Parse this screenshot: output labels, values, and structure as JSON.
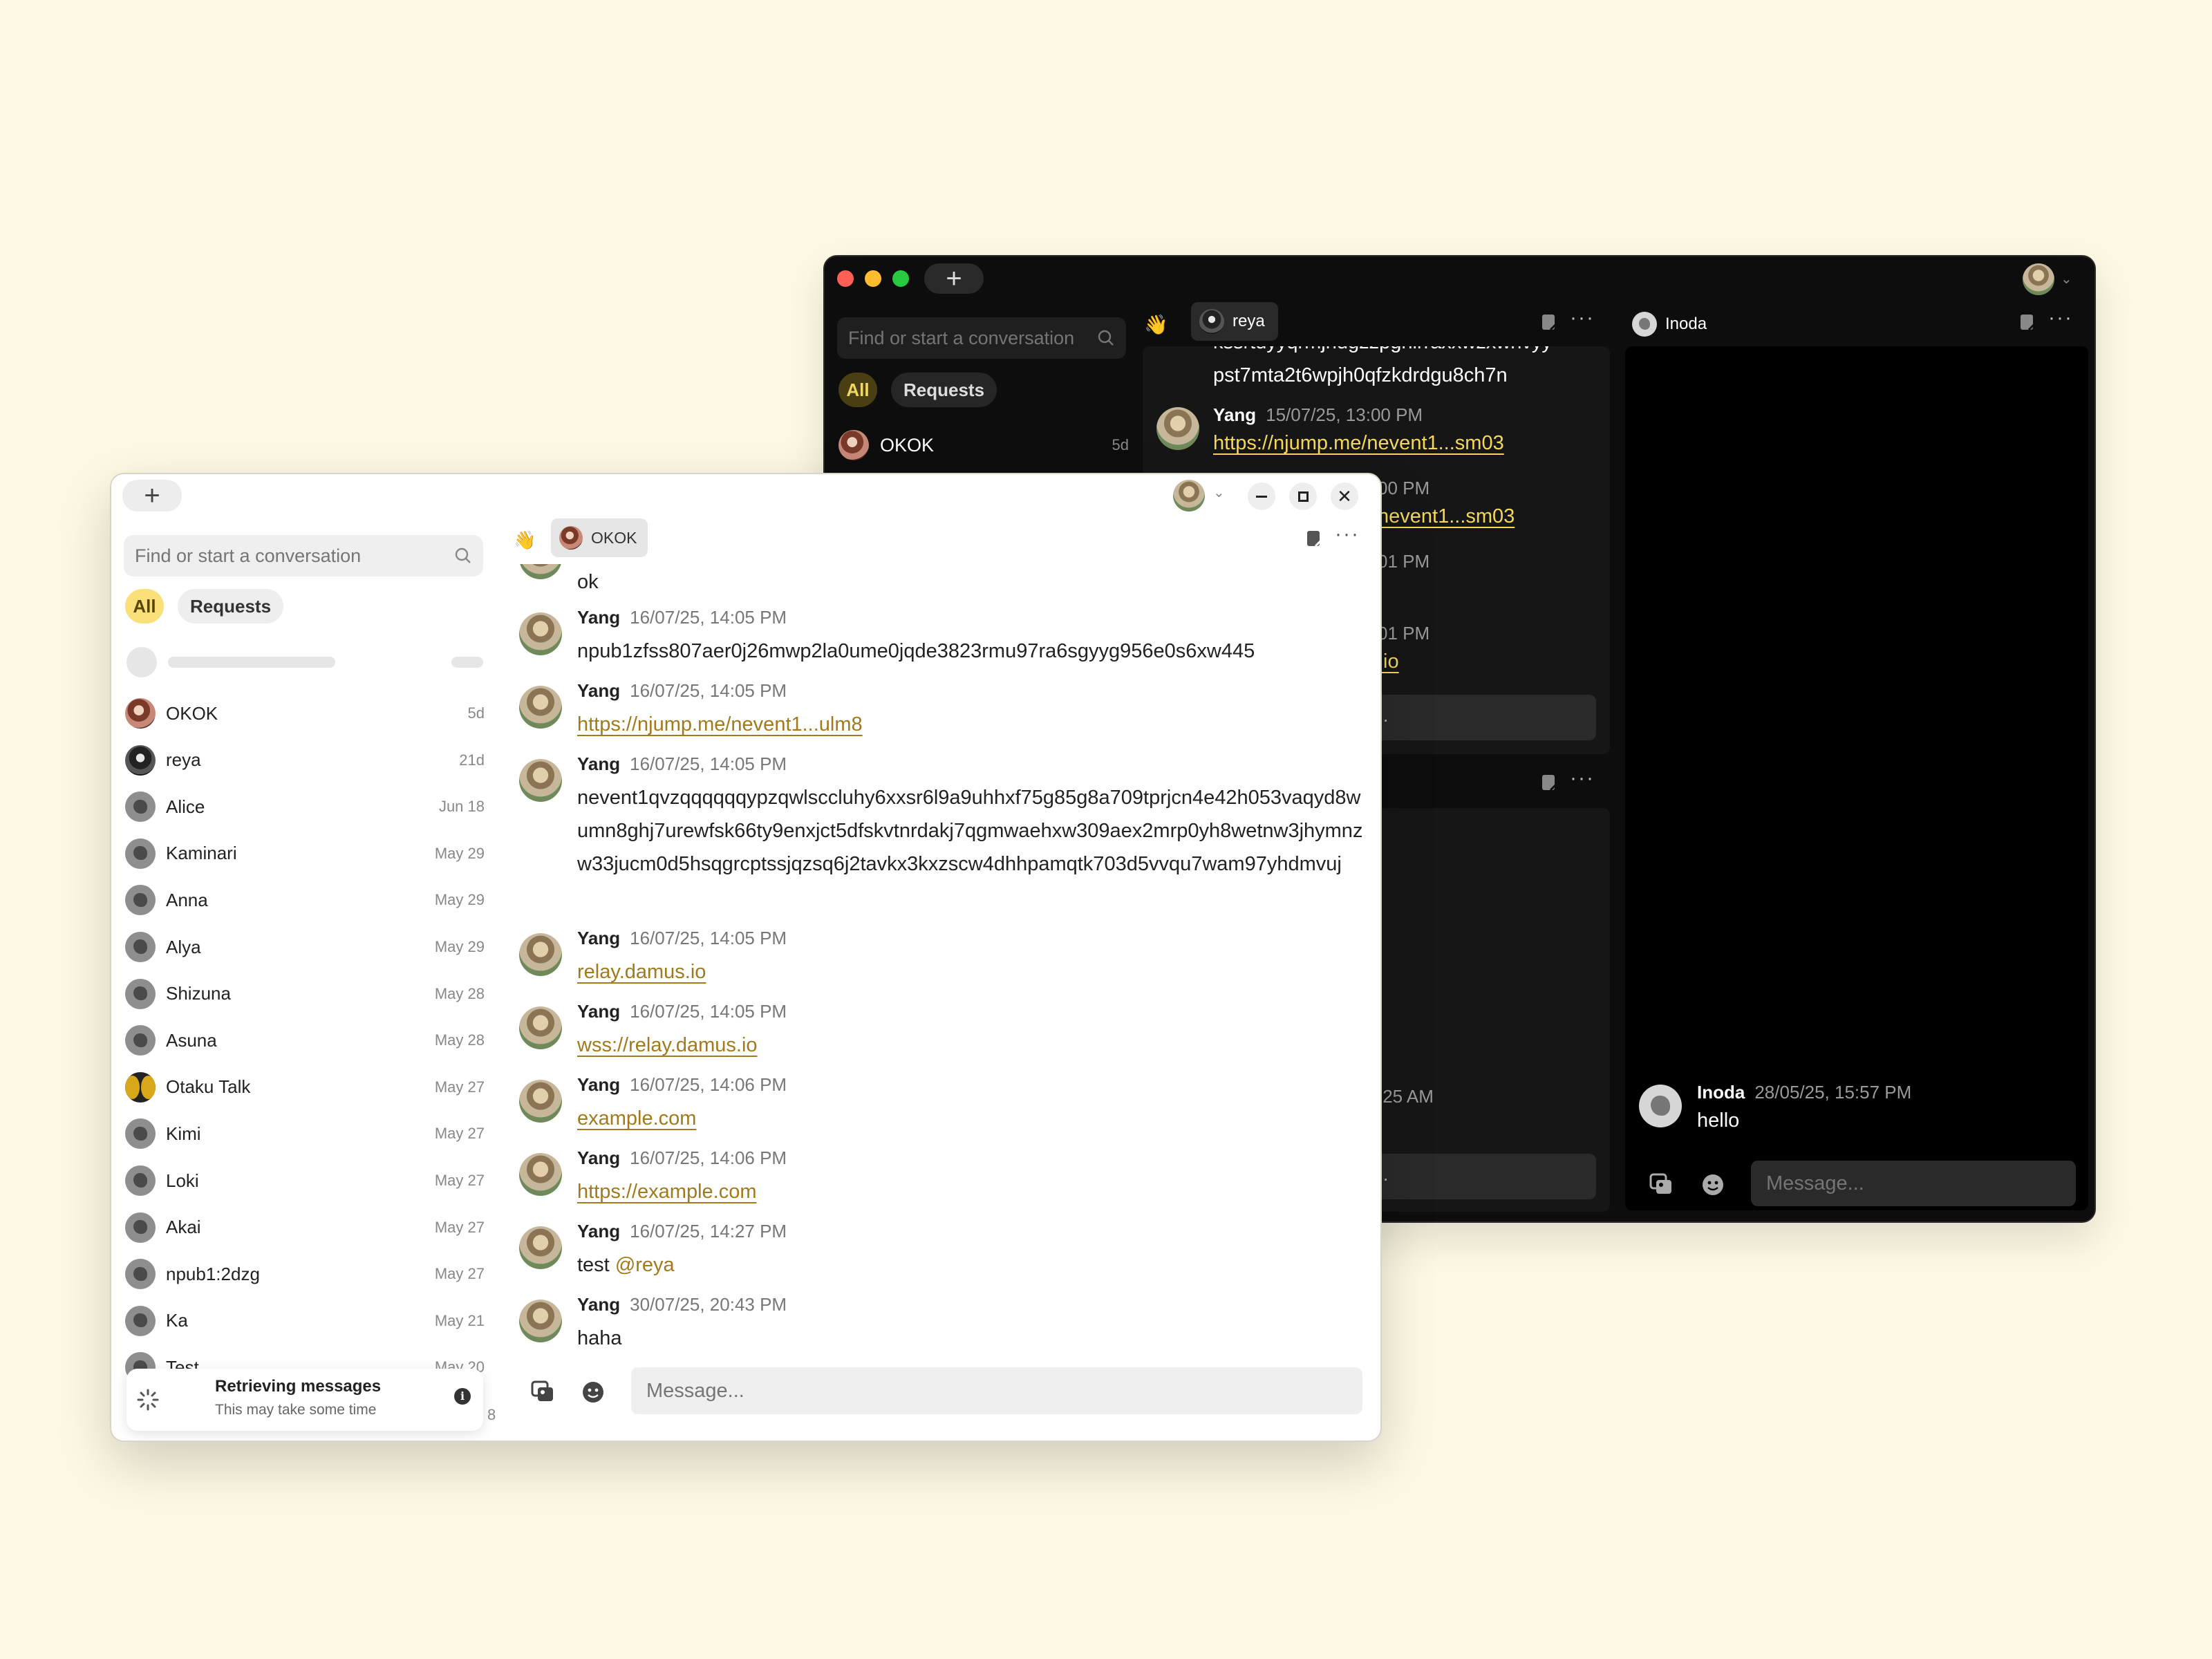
{
  "dark_window": {
    "new_tab": "+",
    "search": {
      "placeholder": "Find or start a conversation"
    },
    "filters": {
      "all": "All",
      "requests": "Requests"
    },
    "conversations": [
      {
        "name": "OKOK",
        "time": "5d"
      }
    ],
    "chat_left": {
      "wave_emoji": "👋",
      "tab": "reya",
      "partial_top": "kssrtdyyqrmjhdgzzpgnirraxxwzxwnvyy",
      "messages": [
        {
          "continuation": "pst7mta2t6wpjh0qfzkdrdgu8ch7n"
        },
        {
          "author": "Yang",
          "time": "15/07/25, 13:00 PM",
          "body": "https://njump.me/nevent1...sm03"
        },
        {
          "time_partial": "00 PM",
          "link_partial": "nevent1...sm03"
        },
        {
          "time_partial": "01 PM"
        },
        {
          "time_partial": "01 PM",
          "link_partial": ".io"
        }
      ],
      "input_partial": "..",
      "lower_time_partial": ":25 AM",
      "lower_input_partial": ".."
    },
    "chat_right": {
      "tab": "Inoda",
      "message": {
        "author": "Inoda",
        "time": "28/05/25, 15:57 PM",
        "body": "hello"
      },
      "input": {
        "placeholder": "Message..."
      }
    }
  },
  "light_window": {
    "new_tab": "+",
    "search": {
      "placeholder": "Find or start a conversation"
    },
    "filters": {
      "all": "All",
      "requests": "Requests"
    },
    "conversations": [
      {
        "name": "OKOK",
        "time": "5d",
        "avatar": "okok"
      },
      {
        "name": "reya",
        "time": "21d",
        "avatar": "reya"
      },
      {
        "name": "Alice",
        "time": "Jun 18",
        "avatar": "default"
      },
      {
        "name": "Kaminari",
        "time": "May 29",
        "avatar": "default"
      },
      {
        "name": "Anna",
        "time": "May 29",
        "avatar": "default"
      },
      {
        "name": "Alya",
        "time": "May 29",
        "avatar": "default"
      },
      {
        "name": "Shizuna",
        "time": "May 28",
        "avatar": "default"
      },
      {
        "name": "Asuna",
        "time": "May 28",
        "avatar": "default"
      },
      {
        "name": "Otaku Talk",
        "time": "May 27",
        "avatar": "otaku"
      },
      {
        "name": "Kimi",
        "time": "May 27",
        "avatar": "default"
      },
      {
        "name": "Loki",
        "time": "May 27",
        "avatar": "default"
      },
      {
        "name": "Akai",
        "time": "May 27",
        "avatar": "default"
      },
      {
        "name": "npub1:2dzg",
        "time": "May 27",
        "avatar": "default"
      },
      {
        "name": "Ka",
        "time": "May 21",
        "avatar": "default"
      },
      {
        "name": "Test",
        "time": "May 20",
        "avatar": "default"
      }
    ],
    "toast": {
      "title": "Retrieving messages",
      "subtitle": "This may take some time",
      "info_glyph": "i",
      "partial_time": "8"
    },
    "chat": {
      "wave_emoji": "👋",
      "tab": "OKOK",
      "first_body": "ok",
      "messages": [
        {
          "author": "Yang",
          "time": "16/07/25, 14:05 PM",
          "body": "npub1zfss807aer0j26mwp2la0ume0jqde3823rmu97ra6sgyyg956e0s6xw445"
        },
        {
          "author": "Yang",
          "time": "16/07/25, 14:05 PM",
          "body": "https://njump.me/nevent1...ulm8"
        },
        {
          "author": "Yang",
          "time": "16/07/25, 14:05 PM",
          "body": "nevent1qvzqqqqqqypzqwlsccluhy6xxsr6l9a9uhhxf75g85g8a709tprjcn4e42h053vaqyd8wumn8ghj7urewfsk66ty9enxjct5dfskvtnrdakj7qgmwaehxw309aex2mrp0yh8wetnw3jhymnzw33jucm0d5hsqgrcptssjqzsq6j2tavkx3kxzscw4dhhpamqtk703d5vvqu7wam97yhdmvuj"
        },
        {
          "author": "Yang",
          "time": "16/07/25, 14:05 PM",
          "body": "relay.damus.io"
        },
        {
          "author": "Yang",
          "time": "16/07/25, 14:05 PM",
          "body": "wss://relay.damus.io"
        },
        {
          "author": "Yang",
          "time": "16/07/25, 14:06 PM",
          "body": "example.com"
        },
        {
          "author": "Yang",
          "time": "16/07/25, 14:06 PM",
          "body": "https://example.com"
        },
        {
          "author": "Yang",
          "time": "16/07/25, 14:27 PM",
          "body": "test ",
          "mention": "@reya"
        },
        {
          "author": "Yang",
          "time": "30/07/25, 20:43 PM",
          "body": "haha"
        }
      ],
      "input": {
        "placeholder": "Message..."
      }
    }
  },
  "colors": {
    "accent_yellow": "#fbe07a",
    "link_light": "#a27a1c",
    "link_dark": "#f5d85a",
    "page_bg": "#fdf9e4"
  }
}
